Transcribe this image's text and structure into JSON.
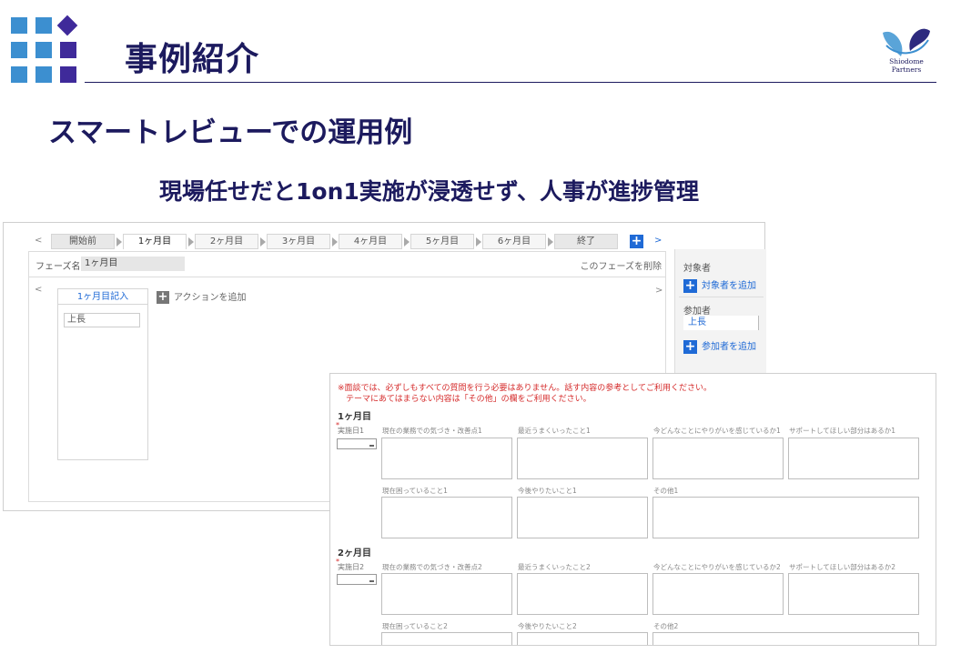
{
  "header": {
    "title": "事例紹介",
    "brand": "Shiodome Partners"
  },
  "subtitle": "スマートレビューでの運用例",
  "tagline": "現場任せだと1on1実施が浸透せず、人事が進捗管理",
  "screen1": {
    "nav_prev": "<",
    "nav_next": ">",
    "phases": [
      "開始前",
      "1ヶ月目",
      "2ヶ月目",
      "3ヶ月目",
      "4ヶ月目",
      "5ヶ月目",
      "6ヶ月目",
      "終了"
    ],
    "active_phase_index": 1,
    "add_phase": "+",
    "phase_name_label": "フェーズ名:",
    "phase_name_value": "1ヶ月目",
    "delete_phase": "このフェーズを削除",
    "inner_prev": "<",
    "inner_next": ">",
    "column_title": "1ヶ月目記入",
    "column_item": "上長",
    "add_action": "アクションを追加",
    "sidebar": {
      "target_label": "対象者",
      "add_target": "対象者を追加",
      "participant_label": "参加者",
      "participant_value": "上長",
      "add_participant": "参加者を追加"
    }
  },
  "screen2": {
    "notice_line1": "※面談では、必ずしもすべての質問を行う必要はありません。話す内容の参考としてご利用ください。",
    "notice_line2": "テーマにあてはまらない内容は「その他」の欄をご利用ください。",
    "months": [
      {
        "heading": "1ヶ月目",
        "date_label": "実施日1",
        "questions_row1": [
          "現在の業務での気づき・改善点1",
          "最近うまくいったこと1",
          "今どんなことにやりがいを感じているか1",
          "サポートしてほしい部分はあるか1"
        ],
        "questions_row2": [
          "現在困っていること1",
          "今後やりたいこと1",
          "その他1"
        ]
      },
      {
        "heading": "2ヶ月目",
        "date_label": "実施日2",
        "questions_row1": [
          "現在の業務での気づき・改善点2",
          "最近うまくいったこと2",
          "今どんなことにやりがいを感じているか2",
          "サポートしてほしい部分はあるか2"
        ],
        "questions_row2": [
          "現在困っていること2",
          "今後やりたいこと2",
          "その他2"
        ]
      }
    ],
    "required_mark": "*"
  },
  "colors": {
    "navy": "#1c1a5e",
    "accent_blue": "#1f6ad6",
    "light_blue": "#3c8fd0",
    "purple": "#3f2a9a",
    "notice_red": "#d52b2b"
  }
}
